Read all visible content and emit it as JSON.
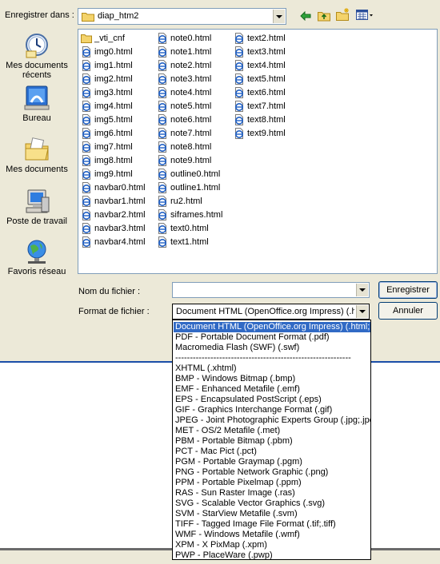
{
  "header": {
    "save_in_label": "Enregistrer dans :",
    "current_folder": "diap_htm2"
  },
  "sidebar": {
    "items": [
      {
        "label": "Mes documents récents"
      },
      {
        "label": "Bureau"
      },
      {
        "label": "Mes documents"
      },
      {
        "label": "Poste de travail"
      },
      {
        "label": "Favoris réseau"
      }
    ]
  },
  "files": {
    "col1": [
      "_vti_cnf",
      "img0.html",
      "img1.html",
      "img2.html",
      "img3.html",
      "img4.html",
      "img5.html",
      "img6.html",
      "img7.html",
      "img8.html",
      "img9.html",
      "navbar0.html",
      "navbar1.html",
      "navbar2.html",
      "navbar3.html",
      "navbar4.html"
    ],
    "col2": [
      "note0.html",
      "note1.html",
      "note2.html",
      "note3.html",
      "note4.html",
      "note5.html",
      "note6.html",
      "note7.html",
      "note8.html",
      "note9.html",
      "outline0.html",
      "outline1.html",
      "ru2.html",
      "siframes.html",
      "text0.html",
      "text1.html"
    ],
    "col3": [
      "text2.html",
      "text3.html",
      "text4.html",
      "text5.html",
      "text6.html",
      "text7.html",
      "text8.html",
      "text9.html"
    ]
  },
  "form": {
    "filename_label": "Nom du fichier :",
    "filename_value": "",
    "format_label": "Format de fichier :",
    "format_value": "Document HTML (OpenOffice.org Impress) (.htm"
  },
  "buttons": {
    "save": "Enregistrer",
    "cancel": "Annuler"
  },
  "format_options": [
    "Document HTML (OpenOffice.org Impress) (.html;.htm)",
    "PDF - Portable Document Format (.pdf)",
    "Macromedia Flash (SWF) (.swf)",
    "------------------------------------------------------------",
    "XHTML (.xhtml)",
    "BMP - Windows Bitmap (.bmp)",
    "EMF - Enhanced Metafile (.emf)",
    "EPS - Encapsulated PostScript (.eps)",
    "GIF - Graphics Interchange Format (.gif)",
    "JPEG - Joint Photographic Experts Group (.jpg;.jpeg;.jfif;.jif;.jpe)",
    "MET - OS/2 Metafile (.met)",
    "PBM - Portable Bitmap (.pbm)",
    "PCT - Mac Pict (.pct)",
    "PGM - Portable Graymap (.pgm)",
    "PNG - Portable Network Graphic (.png)",
    "PPM - Portable Pixelmap (.ppm)",
    "RAS - Sun Raster Image (.ras)",
    "SVG - Scalable Vector Graphics (.svg)",
    "SVM - StarView Metafile (.svm)",
    "TIFF - Tagged Image File Format (.tif;.tiff)",
    "WMF - Windows Metafile (.wmf)",
    "XPM - X PixMap (.xpm)",
    "PWP - PlaceWare (.pwp)"
  ],
  "colors": {
    "dialog_bg": "#ece9d8",
    "selection": "#316ac5",
    "border": "#7f9db9"
  }
}
